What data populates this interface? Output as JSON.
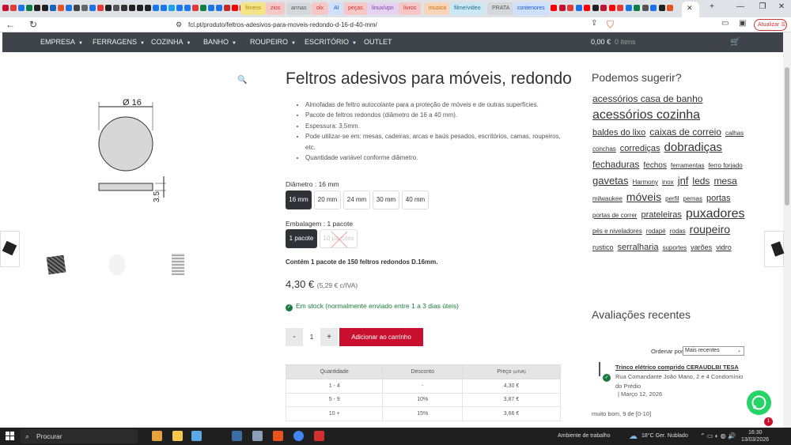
{
  "browser": {
    "bookmark_folders": [
      "fitness",
      "zios",
      "armas",
      "olx",
      "AI",
      "peças",
      "linux/vpn",
      "livros",
      "musica",
      "filme/video",
      "PRATA",
      "contenores"
    ],
    "url": "fcl.pt/produto/feltros-adesivos-para-moveis-redondo-d-16-d-40-mm/",
    "update_label": "Atualizar",
    "tab_close": "✕",
    "new_tab": "+",
    "win_min": "—",
    "win_max": "❐",
    "win_close": "✕"
  },
  "site_nav": {
    "items": [
      "EMPRESA",
      "FERRAGENS",
      "COZINHA",
      "BANHO",
      "ROUPEIRO",
      "ESCRITÓRIO",
      "OUTLET"
    ],
    "cart_total": "0,00 €",
    "cart_items": "0 itens"
  },
  "product": {
    "title": "Feltros adesivos para móveis, redondo",
    "features": [
      "Almofadas de feltro autocolante para a proteção de móveis e de outras superfícies.",
      "Pacote de feltros redondos (diâmetro de 16 a 40 mm).",
      "Espessura: 3,5mm.",
      "Pode utilizar-se em: mesas, cadeiras, arcas e baús pesados, escritórios, camas, roupeiros, etc.",
      "Quantidade variável conforme diâmetro."
    ],
    "drawing": {
      "diameter_label": "Ø 16",
      "thickness_label": "3.5"
    },
    "diameter_label": "Diâmetro : 16 mm",
    "diameter_options": [
      "16 mm",
      "20 mm",
      "24 mm",
      "30 mm",
      "40 mm"
    ],
    "pack_label": "Embalagem : 1 pacote",
    "pack_options": [
      "1 pacote",
      "10 pacotes"
    ],
    "contains": "Contém 1 pacote de 150 feltros redondos D.16mm.",
    "price": "4,30 €",
    "price_vat": "(5,29 € c/IVA)",
    "stock": "Em stock (normalmente enviado entre 1 a 3 dias úteis)",
    "qty_minus": "-",
    "qty": "1",
    "qty_plus": "+",
    "add_to_cart": "Adicionar ao carrinho",
    "discount_table": {
      "headers": [
        "Quantidade",
        "Desconto",
        "Preço"
      ],
      "price_suffix": "(s/IVA)",
      "rows": [
        [
          "1 - 4",
          "-",
          "4,30 €"
        ],
        [
          "5 - 9",
          "10%",
          "3,87 €"
        ],
        [
          "10 +",
          "15%",
          "3,66 €"
        ]
      ]
    }
  },
  "sidebar": {
    "suggest_title": "Podemos sugerir?",
    "tags": [
      {
        "t": "acessórios casa de banho",
        "s": 12
      },
      {
        "t": "acessórios cozinha",
        "s": 16
      },
      {
        "t": "baldes do lixo",
        "s": 11
      },
      {
        "t": "caixas de correio",
        "s": 12
      },
      {
        "t": "calhas",
        "s": 8
      },
      {
        "t": "conchas",
        "s": 8
      },
      {
        "t": "corrediças",
        "s": 11
      },
      {
        "t": "dobradiças",
        "s": 15
      },
      {
        "t": "fechaduras",
        "s": 12
      },
      {
        "t": "fechos",
        "s": 10
      },
      {
        "t": "ferramentas",
        "s": 8
      },
      {
        "t": "ferro forjado",
        "s": 8
      },
      {
        "t": "gavetas",
        "s": 13
      },
      {
        "t": "Harmony",
        "s": 8
      },
      {
        "t": "inox",
        "s": 8
      },
      {
        "t": "jnf",
        "s": 13
      },
      {
        "t": "leds",
        "s": 12
      },
      {
        "t": "mesa",
        "s": 12
      },
      {
        "t": "milwaukee",
        "s": 8
      },
      {
        "t": "móveis",
        "s": 14
      },
      {
        "t": "perfil",
        "s": 8
      },
      {
        "t": "pernas",
        "s": 8
      },
      {
        "t": "portas",
        "s": 11
      },
      {
        "t": "portas de correr",
        "s": 8
      },
      {
        "t": "prateleiras",
        "s": 11
      },
      {
        "t": "puxadores",
        "s": 16
      },
      {
        "t": "pés e niveladores",
        "s": 8
      },
      {
        "t": "rodapé",
        "s": 8
      },
      {
        "t": "rodas",
        "s": 8
      },
      {
        "t": "roupeiro",
        "s": 14
      },
      {
        "t": "rustico",
        "s": 9
      },
      {
        "t": "serralharia",
        "s": 11
      },
      {
        "t": "suportes",
        "s": 8
      },
      {
        "t": "varões",
        "s": 9
      },
      {
        "t": "vidro",
        "s": 9
      }
    ],
    "reviews_title": "Avaliações recentes",
    "order_label": "Ordenar por",
    "order_value": "Mais recentes",
    "review": {
      "product": "Trinco elétrico comprido CERAUDLBI TESA",
      "author": "Rua Comandante João Mano, 2 e 4 Condomínio do Prédio",
      "date": "Março 12, 2026",
      "text": "muito bom, 9 de [0-10]"
    },
    "whatsapp_badge": "1"
  },
  "taskbar": {
    "search": "Procurar",
    "desktop": "Ambiente de trabalho",
    "weather": "18°C  Ger. Nublado",
    "time": "16:30",
    "date": "13/03/2026"
  },
  "colors": {
    "accent": "#c8102e",
    "nav": "#3e4449",
    "stock": "#1a7a3c"
  }
}
